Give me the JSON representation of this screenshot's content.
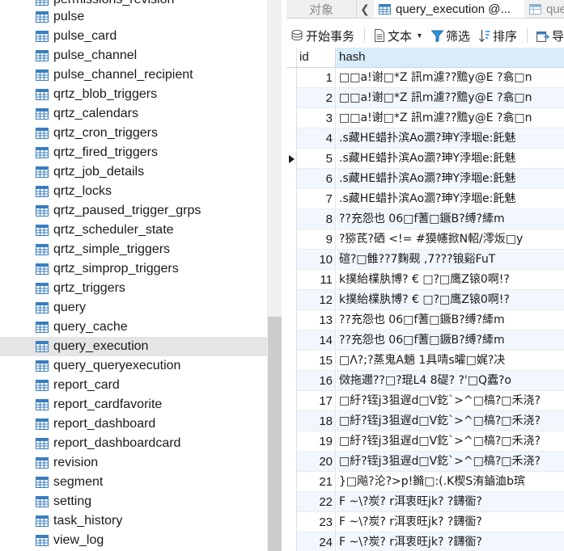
{
  "tree": {
    "partial_top_label": "permissions_revision",
    "items": [
      "pulse",
      "pulse_card",
      "pulse_channel",
      "pulse_channel_recipient",
      "qrtz_blob_triggers",
      "qrtz_calendars",
      "qrtz_cron_triggers",
      "qrtz_fired_triggers",
      "qrtz_job_details",
      "qrtz_locks",
      "qrtz_paused_trigger_grps",
      "qrtz_scheduler_state",
      "qrtz_simple_triggers",
      "qrtz_simprop_triggers",
      "qrtz_triggers",
      "query",
      "query_cache",
      "query_execution",
      "query_queryexecution",
      "report_card",
      "report_cardfavorite",
      "report_dashboard",
      "report_dashboardcard",
      "revision",
      "segment",
      "setting",
      "task_history",
      "view_log"
    ],
    "selected": "query_execution"
  },
  "tabs": {
    "objects": "对象",
    "active": "query_execution @...",
    "next": "que"
  },
  "toolbar": {
    "begin_transaction": "开始事务",
    "text": "文本",
    "filter": "筛选",
    "sort": "排序",
    "export": "导"
  },
  "grid": {
    "columns": [
      "id",
      "hash"
    ],
    "current_row": 5,
    "rows": [
      {
        "id": "1",
        "hash": "□□a!谢□*Z   訊m濾??黵y@E    ?翕□n"
      },
      {
        "id": "2",
        "hash": "□□a!谢□*Z   訊m濾??黵y@E    ?翕□n"
      },
      {
        "id": "3",
        "hash": "□□a!谢□*Z   訊m濾??黵y@E    ?翕□n"
      },
      {
        "id": "4",
        "hash": ".s藏HE蜡扑滨Ao瀱?珅Y浡堌e:飥魅"
      },
      {
        "id": "5",
        "hash": ".s藏HE蜡扑滨Ao瀱?珅Y浡堌e:飥魅"
      },
      {
        "id": "6",
        "hash": ".s藏HE蜡扑滨Ao瀱?珅Y浡堌e:飥魅"
      },
      {
        "id": "7",
        "hash": ".s藏HE蜡扑滨Ao瀱?珅Y浡堌e:飥魅"
      },
      {
        "id": "8",
        "hash": "??充怨也   06□f蓍□鐝B?缚?縴m"
      },
      {
        "id": "9",
        "hash": "?猕茋?硒 <!=   #獏幰掀N軺/澪炍□y"
      },
      {
        "id": "10",
        "hash": "碹?□雔??7麴觋 ,7???锒谿FuT"
      },
      {
        "id": "11",
        "hash": "k撲紿檏肒博?   € □?□鹰Z锿0啊!?"
      },
      {
        "id": "12",
        "hash": "k撲紿檏肒博?   € □?□鹰Z锿0啊!?"
      },
      {
        "id": "13",
        "hash": "??充怨也   06□f蓍□鐝B?缚?縴m"
      },
      {
        "id": "14",
        "hash": "??充怨也   06□f蓍□鐝B?缚?縴m"
      },
      {
        "id": "15",
        "hash": "□Λ?;?蒸鬼A魎   1具啨s曤□娓?决"
      },
      {
        "id": "16",
        "hash": "傚拖邇??□?琨L4  8碮? ?'□Q蠹?o"
      },
      {
        "id": "17",
        "hash": "□紆?铚j3狙遅d□V釳`>^□槁?□禾浇?"
      },
      {
        "id": "18",
        "hash": "□紆?铚j3狙遅d□V釳`>^□槁?□禾浇?"
      },
      {
        "id": "19",
        "hash": "□紆?铚j3狙遅d□V釳`>^□槁?□禾浇?"
      },
      {
        "id": "20",
        "hash": "□紆?铚j3狙遅d□V釳`>^□槁?□禾浇?"
      },
      {
        "id": "21",
        "hash": "}□飚?沦?>p!鏅□:(.K楔S洧鏀洫b瑸"
      },
      {
        "id": "22",
        "hash": "F  ~\\?炭? r洱衷旺jk?    ?鑮衟?"
      },
      {
        "id": "23",
        "hash": "F  ~\\?炭? r洱衷旺jk?    ?鑮衟?"
      },
      {
        "id": "24",
        "hash": "F  ~\\?炭? r洱衷旺jk?    ?鑮衟?"
      }
    ]
  },
  "colors": {
    "selected_item_bg": "#e5e5e5",
    "header_bg": "#eaf4fb",
    "hash_header_bg": "#d9ecf9",
    "alt_row_bg": "#f1f7fc",
    "table_icon": "#3a7ebf"
  },
  "icons": {
    "table": "table-icon",
    "tab_table": "table-icon",
    "begin_transaction": "transaction-icon",
    "text": "text-document-icon",
    "filter": "filter-icon",
    "sort": "sort-icon",
    "export": "export-icon",
    "current_row": "row-pointer-icon"
  }
}
